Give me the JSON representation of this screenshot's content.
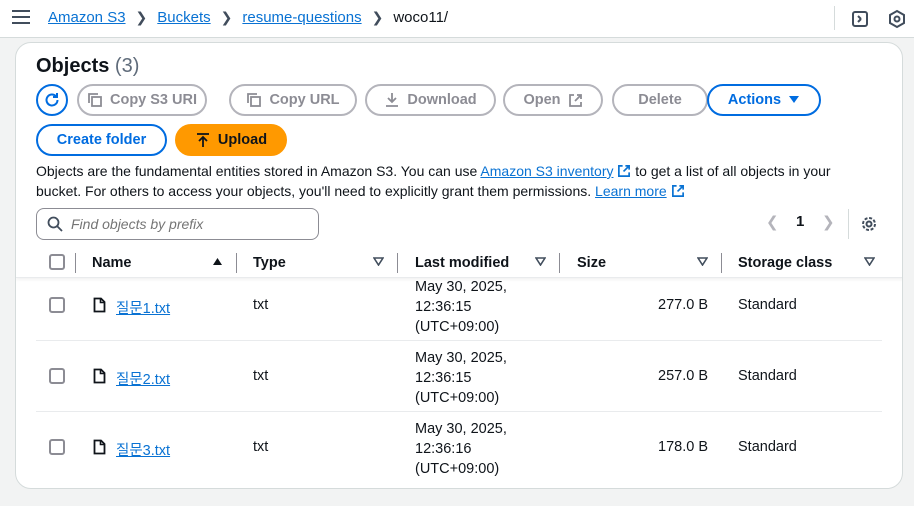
{
  "breadcrumbs": {
    "items": [
      "Amazon S3",
      "Buckets",
      "resume-questions"
    ],
    "current": "woco11/"
  },
  "objects": {
    "title": "Objects",
    "count": "(3)"
  },
  "toolbar": {
    "copy_s3_uri": "Copy S3 URI",
    "copy_url": "Copy URL",
    "download": "Download",
    "open": "Open",
    "delete": "Delete",
    "actions": "Actions",
    "create_folder": "Create folder",
    "upload": "Upload"
  },
  "description": {
    "part1": "Objects are the fundamental entities stored in Amazon S3. You can use ",
    "link1": "Amazon S3 inventory",
    "part2": " to get a list of all objects in your bucket. For others to access your objects, you'll need to explicitly grant them permissions. ",
    "link2": "Learn more"
  },
  "search": {
    "placeholder": "Find objects by prefix"
  },
  "pagination": {
    "page": "1"
  },
  "table": {
    "columns": [
      "Name",
      "Type",
      "Last modified",
      "Size",
      "Storage class"
    ],
    "rows": [
      {
        "name": "질문1.txt",
        "type": "txt",
        "modified": [
          "May 30, 2025,",
          "12:36:15",
          "(UTC+09:00)"
        ],
        "size": "277.0 B",
        "storage": "Standard"
      },
      {
        "name": "질문2.txt",
        "type": "txt",
        "modified": [
          "May 30, 2025,",
          "12:36:15",
          "(UTC+09:00)"
        ],
        "size": "257.0 B",
        "storage": "Standard"
      },
      {
        "name": "질문3.txt",
        "type": "txt",
        "modified": [
          "May 30, 2025,",
          "12:36:16",
          "(UTC+09:00)"
        ],
        "size": "178.0 B",
        "storage": "Standard"
      }
    ]
  },
  "colors": {
    "link": "#0972d3",
    "primary": "#006ce0",
    "upload": "#ff9900",
    "disabled": "#8c8c94"
  },
  "icons": [
    "menu-icon",
    "chevron-right-icon",
    "side-panel-icon",
    "notifications-icon",
    "refresh-icon",
    "copy-icon",
    "download-icon",
    "external-link-icon",
    "caret-down-icon",
    "upload-icon",
    "search-icon",
    "chevron-left-icon",
    "settings-icon",
    "sort-ascending-icon",
    "file-icon"
  ]
}
